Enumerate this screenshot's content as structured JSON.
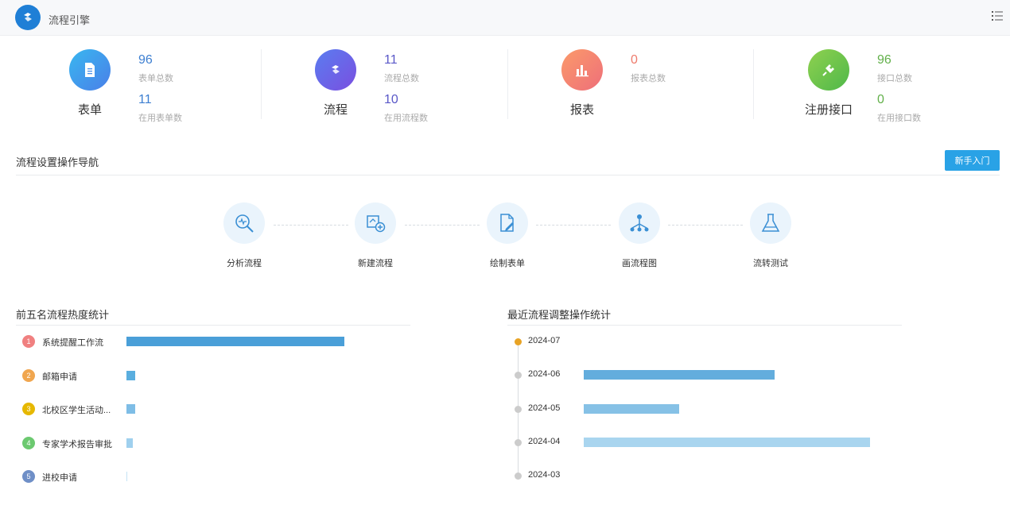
{
  "header": {
    "title": "流程引擎"
  },
  "stats": [
    {
      "name": "表单",
      "value1": "96",
      "label1": "表单总数",
      "value2": "11",
      "label2": "在用表单数",
      "icon": "document-icon",
      "color": "#4a8fea",
      "numColor": "#3d7fd1"
    },
    {
      "name": "流程",
      "value1": "11",
      "label1": "流程总数",
      "value2": "10",
      "label2": "在用流程数",
      "icon": "flow-icon",
      "color": "#6a5ee8",
      "numColor": "#5a58c8"
    },
    {
      "name": "报表",
      "value1": "0",
      "label1": "报表总数",
      "value2": "",
      "label2": "",
      "icon": "bar-chart-icon",
      "color": "#f07a6b",
      "numColor": "#ee7b6c"
    },
    {
      "name": "注册接口",
      "value1": "96",
      "label1": "接口总数",
      "value2": "0",
      "label2": "在用接口数",
      "icon": "plug-icon",
      "color": "#6cc24a",
      "numColor": "#62b04a"
    }
  ],
  "guide": {
    "title": "流程设置操作导航",
    "button": "新手入门",
    "steps": [
      {
        "label": "分析流程",
        "icon": "analyze-magnifier-icon"
      },
      {
        "label": "新建流程",
        "icon": "new-flow-icon"
      },
      {
        "label": "绘制表单",
        "icon": "draw-form-icon"
      },
      {
        "label": "画流程图",
        "icon": "flowchart-icon"
      },
      {
        "label": "流转测试",
        "icon": "flask-icon"
      }
    ]
  },
  "ranking": {
    "title": "前五名流程热度统计",
    "items": [
      {
        "rank": "1",
        "name": "系统提醒工作流",
        "value": 100,
        "badgeColor": "#f08080"
      },
      {
        "rank": "2",
        "name": "邮箱申请",
        "value": 4,
        "badgeColor": "#f0a64f"
      },
      {
        "rank": "3",
        "name": "北校区学生活动...",
        "value": 4,
        "badgeColor": "#e6b800"
      },
      {
        "rank": "4",
        "name": "专家学术报告审批",
        "value": 3,
        "badgeColor": "#6cc970"
      },
      {
        "rank": "5",
        "name": "进校申请",
        "value": 0,
        "badgeColor": "#6f8fc7"
      }
    ],
    "colors": [
      "#4a9fd8",
      "#5aaedf",
      "#7ebde6",
      "#9fd0ee",
      "#c5e3f5"
    ]
  },
  "timeline": {
    "title": "最近流程调整操作统计",
    "items": [
      {
        "month": "2024-07",
        "value": 0,
        "dotColor": "#e8a325",
        "barColor": "#6ab3de"
      },
      {
        "month": "2024-06",
        "value": 20,
        "dotColor": "#cccccc",
        "barColor": "#63addd"
      },
      {
        "month": "2024-05",
        "value": 10,
        "dotColor": "#cccccc",
        "barColor": "#86c1e6"
      },
      {
        "month": "2024-04",
        "value": 30,
        "dotColor": "#cccccc",
        "barColor": "#a9d5ef"
      },
      {
        "month": "2024-03",
        "value": 0,
        "dotColor": "#cccccc",
        "barColor": "#c5e3f5"
      }
    ],
    "max": 30
  }
}
